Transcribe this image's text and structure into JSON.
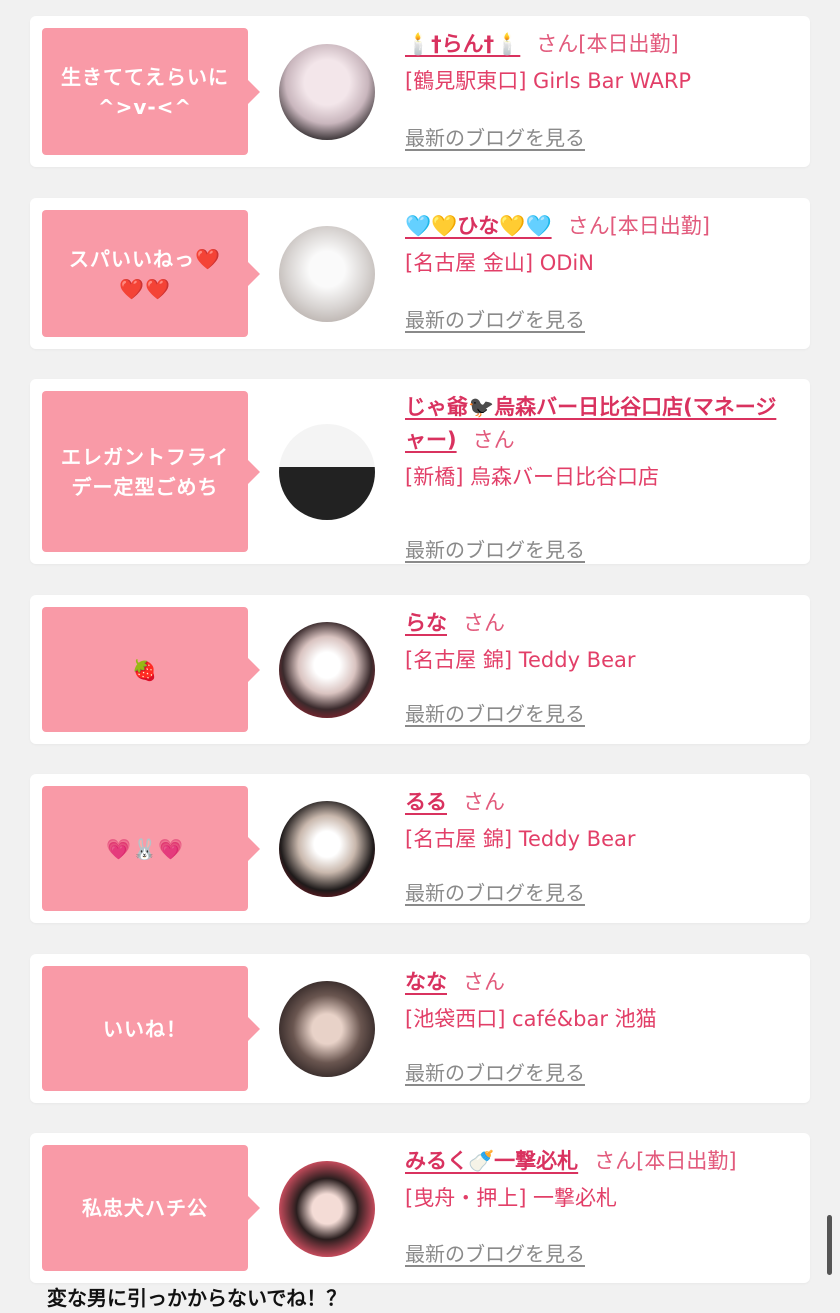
{
  "cards": [
    {
      "comment": "生きててえらいに\n^>v-<^",
      "name": "🕯️†らん†🕯️",
      "san": "さん",
      "tag": "[本日出勤]",
      "shop": "[鶴見駅東口] Girls Bar WARP",
      "blog": "最新のブログを見る"
    },
    {
      "comment": "スパいいねっ❤️\n❤️❤️",
      "name": "🩵💛ひな💛🩵",
      "san": "さん",
      "tag": "[本日出勤]",
      "shop": "[名古屋 金山] ODiN",
      "blog": "最新のブログを見る"
    },
    {
      "comment": "エレガントフライ\nデー定型ごめち",
      "name": "じゃ爺🐦‍⬛烏森バー日比谷口店(マネージャー)",
      "san": "さん",
      "tag": "",
      "shop": "[新橋] 烏森バー日比谷口店",
      "blog": "最新のブログを見る"
    },
    {
      "comment": "🍓",
      "name": "らな",
      "san": "さん",
      "tag": "",
      "shop": "[名古屋 錦] Teddy Bear",
      "blog": "最新のブログを見る"
    },
    {
      "comment": "💗🐰💗",
      "name": "るる",
      "san": "さん",
      "tag": "",
      "shop": "[名古屋 錦] Teddy Bear",
      "blog": "最新のブログを見る"
    },
    {
      "comment": "いいね！",
      "name": "なな",
      "san": "さん",
      "tag": "",
      "shop": "[池袋西口] café&bar 池猫",
      "blog": "最新のブログを見る"
    },
    {
      "comment": "私忠犬ハチ公",
      "name": "みるく🍼一撃必札",
      "san": "さん",
      "tag": "[本日出勤]",
      "shop": "[曳舟・押上] 一撃必札",
      "blog": "最新のブログを見る"
    }
  ],
  "footer": {
    "text": "変な男に引っかからないでね！？"
  },
  "colors": {
    "bubble": "#f99aa7",
    "name": "#d9325f",
    "link_gray": "#8a8a8a",
    "background": "#f1f1f1"
  }
}
